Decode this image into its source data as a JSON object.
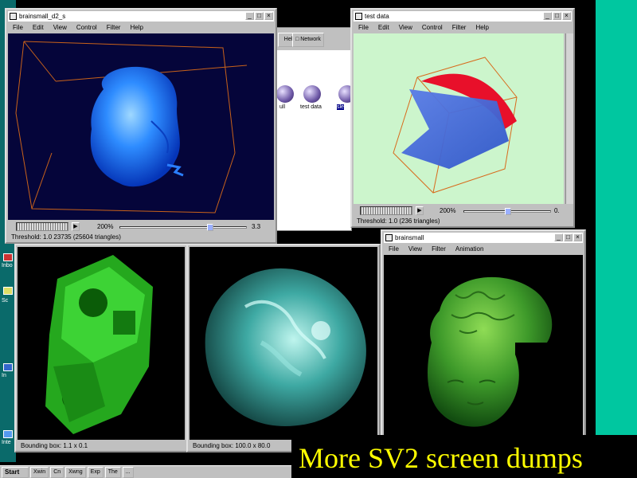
{
  "slide": {
    "caption": "More SV2 screen dumps",
    "accent_color": "#00c7a0",
    "caption_color": "#ffff00"
  },
  "desktop": {
    "items": [
      {
        "label": "Inbo"
      },
      {
        "label": "Sc"
      },
      {
        "label": "In"
      },
      {
        "label": "Inte"
      }
    ]
  },
  "window_brain_blue": {
    "title": "brainsmall_d2_s",
    "menu": [
      "File",
      "Edit",
      "View",
      "Control",
      "Filter",
      "Help"
    ],
    "zoom_label": "200%",
    "zoom_value": "3.3",
    "status": "Threshold: 1.0 23735 (25604 triangles)",
    "slider_fraction": 0.72
  },
  "window_explorer": {
    "toolbar_label": "Help",
    "button_label": "Network",
    "files": [
      {
        "label": "ull"
      },
      {
        "label": "test data"
      },
      {
        "label": "sle"
      }
    ]
  },
  "window_test_data": {
    "title": "test data",
    "menu": [
      "File",
      "Edit",
      "View",
      "Control",
      "Filter",
      "Help"
    ],
    "zoom_label": "200%",
    "zoom_value": "0.",
    "status": "Threshold: 1.0 (236 triangles)",
    "slider_fraction": 0.5
  },
  "window_engine": {
    "status": "Bounding box: 1.1 x 0.1"
  },
  "window_head_ct": {
    "status": "Bounding box: 100.0 x 80.0"
  },
  "window_brain_green": {
    "title": "brainsmall",
    "menu": [
      "File",
      "View",
      "Filter",
      "Animation"
    ]
  },
  "taskbar": {
    "start": "Start",
    "items": [
      "Xwin",
      "Cn",
      "Xwng",
      "Exp",
      "The",
      "..."
    ]
  },
  "icons": [
    "window-menu-icon",
    "minimize-icon",
    "maximize-icon",
    "close-icon",
    "play-icon",
    "computer-icon"
  ]
}
